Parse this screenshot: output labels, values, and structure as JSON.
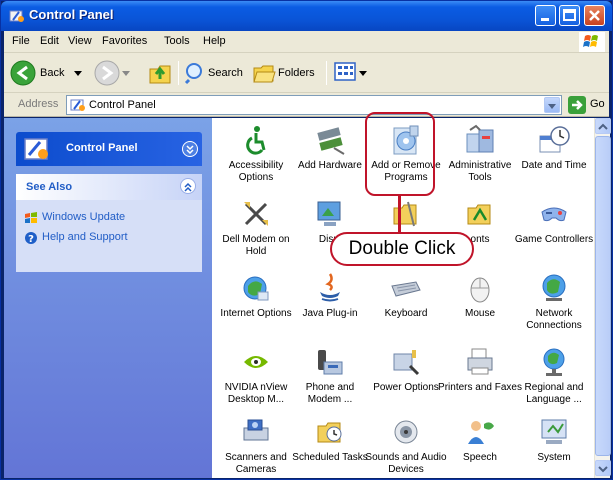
{
  "window": {
    "title": "Control Panel"
  },
  "menu": [
    "File",
    "Edit",
    "View",
    "Favorites",
    "Tools",
    "Help"
  ],
  "toolbar": {
    "back_label": "Back",
    "search_label": "Search",
    "folders_label": "Folders"
  },
  "address": {
    "label": "Address",
    "value": "Control Panel",
    "go_label": "Go"
  },
  "left_pane": {
    "panel_title": "Control Panel",
    "see_also_title": "See Also",
    "links": [
      "Windows Update",
      "Help and Support"
    ]
  },
  "items": [
    {
      "label": "Accessibility Options",
      "icon": "accessibility-icon"
    },
    {
      "label": "Add Hardware",
      "icon": "add-hardware-icon"
    },
    {
      "label": "Add or Remove Programs",
      "icon": "add-remove-programs-icon"
    },
    {
      "label": "Administrative Tools",
      "icon": "administrative-tools-icon"
    },
    {
      "label": "Date and Time",
      "icon": "date-time-icon"
    },
    {
      "label": "Dell Modem on Hold",
      "icon": "dell-modem-icon"
    },
    {
      "label": "Displ",
      "icon": "display-icon"
    },
    {
      "label": "",
      "icon": "folder-options-icon"
    },
    {
      "label": "onts",
      "icon": "fonts-icon"
    },
    {
      "label": "Game Controllers",
      "icon": "game-controllers-icon"
    },
    {
      "label": "Internet Options",
      "icon": "internet-options-icon"
    },
    {
      "label": "Java Plug-in",
      "icon": "java-icon"
    },
    {
      "label": "Keyboard",
      "icon": "keyboard-icon"
    },
    {
      "label": "Mouse",
      "icon": "mouse-icon"
    },
    {
      "label": "Network Connections",
      "icon": "network-icon"
    },
    {
      "label": "NVIDIA nView Desktop M...",
      "icon": "nvidia-icon"
    },
    {
      "label": "Phone and Modem ...",
      "icon": "phone-modem-icon"
    },
    {
      "label": "Power Options",
      "icon": "power-options-icon"
    },
    {
      "label": "Printers and Faxes",
      "icon": "printers-icon"
    },
    {
      "label": "Regional and Language ...",
      "icon": "regional-icon"
    },
    {
      "label": "Scanners and Cameras",
      "icon": "scanners-icon"
    },
    {
      "label": "Scheduled Tasks",
      "icon": "scheduled-tasks-icon"
    },
    {
      "label": "Sounds and Audio Devices",
      "icon": "sounds-icon"
    },
    {
      "label": "Speech",
      "icon": "speech-icon"
    },
    {
      "label": "System",
      "icon": "system-icon"
    }
  ],
  "annotation": {
    "callout_text": "Double Click"
  },
  "colors": {
    "titlebar": "#0a55d8",
    "annotation": "#c0142a",
    "link": "#215dc6"
  }
}
